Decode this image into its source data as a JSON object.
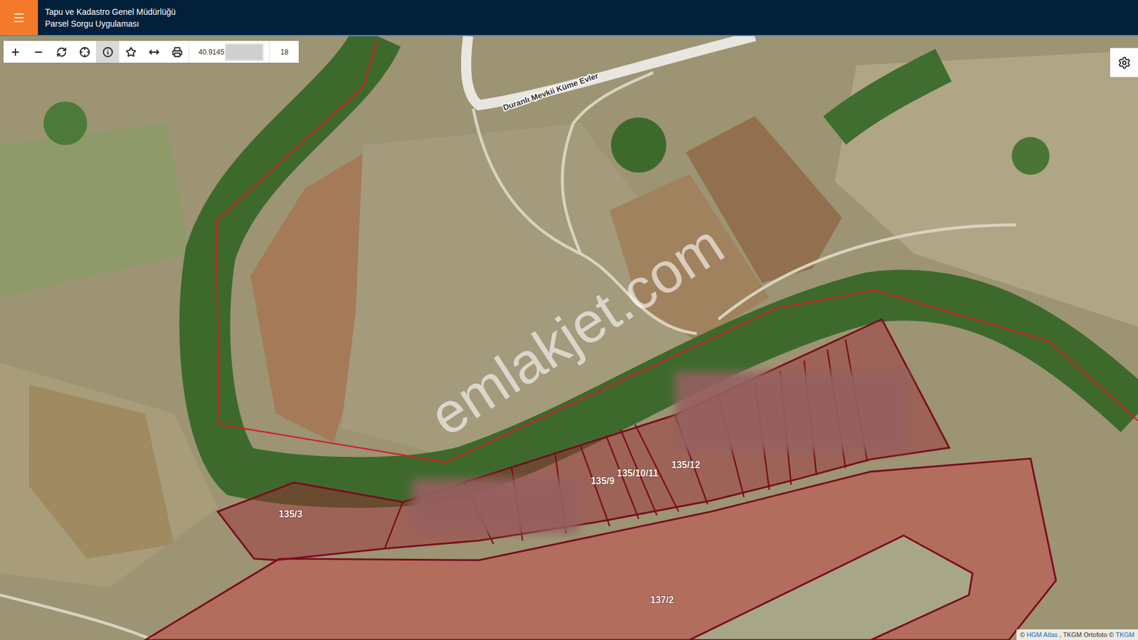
{
  "header": {
    "title": "Tapu ve Kadastro Genel Müdürlüğü",
    "subtitle": "Parsel Sorgu Uygulaması"
  },
  "toolbar": {
    "tools": [
      {
        "kind": "zoom-in",
        "selected": false
      },
      {
        "kind": "zoom-out",
        "selected": false
      },
      {
        "kind": "refresh",
        "selected": false
      },
      {
        "kind": "locate",
        "selected": false
      },
      {
        "kind": "info",
        "selected": true
      },
      {
        "kind": "favorite",
        "selected": false
      },
      {
        "kind": "measure",
        "selected": false
      },
      {
        "kind": "print",
        "selected": false
      }
    ],
    "coordinate": "40.9145",
    "zoom": "18"
  },
  "map": {
    "road_label": "Duranlı Mevkii Küme Evler",
    "parcels": [
      {
        "label": "135/3"
      },
      {
        "label": "135/9"
      },
      {
        "label": "135/10/11"
      },
      {
        "label": "135/12"
      },
      {
        "label": "137/2"
      }
    ],
    "watermark": "emlakjet.com",
    "attribution": [
      {
        "text": "©",
        "link": false
      },
      {
        "text": "HGM Atlas",
        "link": true
      },
      {
        "text": ", TKGM Ortofoto ©",
        "link": false
      },
      {
        "text": "TKGM",
        "link": true
      }
    ]
  }
}
